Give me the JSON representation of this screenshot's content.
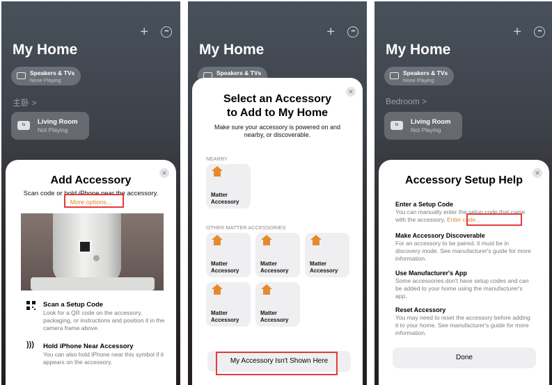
{
  "home": {
    "title": "My Home",
    "speaker_chip": {
      "title": "Speakers & TVs",
      "subtitle": "None Playing"
    },
    "room_labels": [
      "主卧 >",
      "Bedroom >"
    ],
    "living_room_tile": {
      "title": "Living Room",
      "subtitle": "Not Playing",
      "icon_text": "tv"
    }
  },
  "add_accessory": {
    "title": "Add Accessory",
    "subtitle": "Scan code or hold iPhone near the accessory.",
    "more_options": "More options...",
    "items": [
      {
        "title": "Scan a Setup Code",
        "text": "Look for a QR code on the accessory, packaging, or instructions and position it in the camera frame above."
      },
      {
        "title": "Hold iPhone Near Accessory",
        "text": "You can also hold iPhone near this symbol if it appears on the accessory."
      }
    ],
    "nfc_glyph": ")))"
  },
  "select_accessory": {
    "title_line1": "Select an Accessory",
    "title_line2": "to Add to My Home",
    "subtitle": "Make sure your accessory is powered on and nearby, or discoverable.",
    "nearby_label": "NEARBY",
    "other_label": "OTHER MATTER ACCESSORIES",
    "accessory_line1": "Matter",
    "accessory_line2": "Accessory",
    "not_shown_button": "My Accessory Isn't Shown Here"
  },
  "setup_help": {
    "title": "Accessory Setup Help",
    "sections": [
      {
        "title": "Enter a Setup Code",
        "text": "You can manually enter the setup code that came with the accessory.",
        "link": "Enter code..."
      },
      {
        "title": "Make Accessory Discoverable",
        "text": "For an accessory to be paired, it must be in discovery mode. See manufacturer's guide for more information."
      },
      {
        "title": "Use Manufacturer's App",
        "text": "Some accessories don't have setup codes and can be added to your home using the manufacturer's app."
      },
      {
        "title": "Reset Accessory",
        "text": "You may need to reset the accessory before adding it to your home. See manufacturer's guide for more information."
      }
    ],
    "done_button": "Done"
  },
  "icons": {
    "plus": "+",
    "more": "•••",
    "close": "✕"
  },
  "colors": {
    "accent_orange": "#e2862a",
    "highlight_red": "#e23b3b",
    "sheet_bg": "#ffffff",
    "tile_bg": "#efeff1"
  }
}
